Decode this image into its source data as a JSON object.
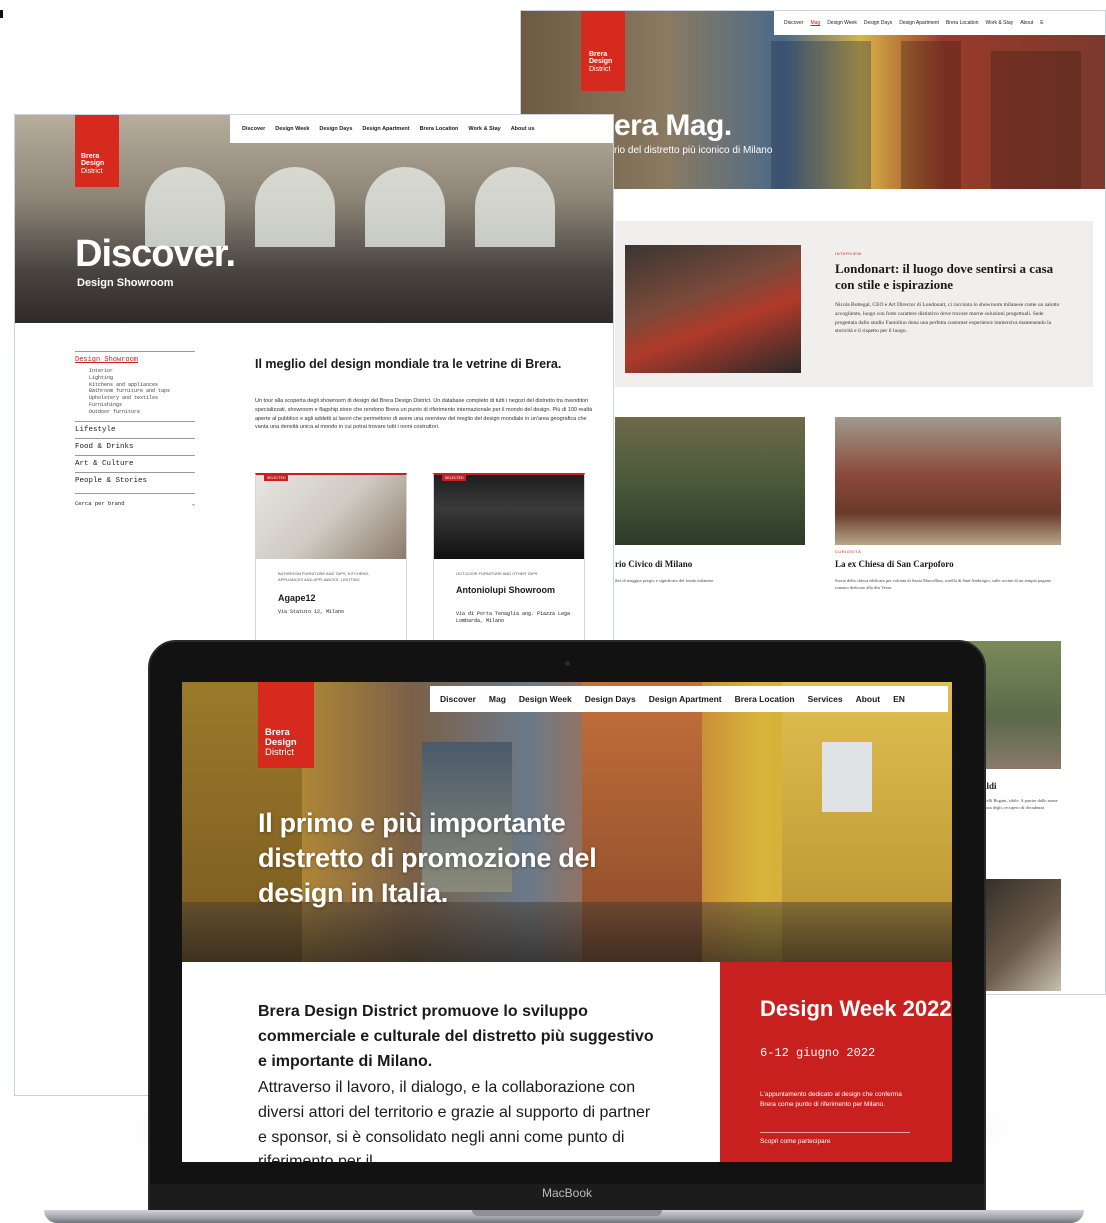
{
  "mag_page": {
    "logo": [
      "Brera",
      "Design",
      "District"
    ],
    "nav": [
      "Discover",
      "Mag",
      "Design Week",
      "Design Days",
      "Design Apartment",
      "Brera Location",
      "Work & Stay",
      "About",
      "E"
    ],
    "active_nav": "Mag",
    "title": "era Mag.",
    "subtitle": "rio del distretto più iconico di Milano",
    "feature": {
      "category": "INTERVIEW",
      "title": "Londonart: il luogo dove sentirsi a casa con stile e ispirazione",
      "text": "Nicola Bottegal, CEO e Art Director di Londonart, ci racconta lo showroom milanese come un salotto accogliente, luogo con forte carattere distintivo dove trovare morne soluzioni progettuali. Sede progettata dallo studio Fantolino dona una perfetta customer experience immersiva mantenendo la storicità e il rispetto per il luogo."
    },
    "cards": [
      {
        "title": "rio Civico di Milano",
        "text": "ibri di maggior pregio e significato del fondo milanese.",
        "category": ""
      },
      {
        "title": "La ex Chiesa di San Carpoforo",
        "text": "Storia della chiesa edificata per volontà di Santa Marcellina, sorella di Sant'Ambrogio, sulle rovine di un tempio pagano romano dedicato alla dea Vesta.",
        "category": "CURIOSITÀ"
      },
      {
        "title": "baldi",
        "text": "i Fratelli Bogani, sibile. A partire dallo nome in storia degli, recupero di decadenza",
        "category": ""
      }
    ]
  },
  "discover_page": {
    "logo": [
      "Brera",
      "Design",
      "District"
    ],
    "nav": [
      "Discover",
      "Design Week",
      "Design Days",
      "Design Apartment",
      "Brera Location",
      "Work & Stay",
      "About us"
    ],
    "title": "Discover.",
    "subtitle": "Design Showroom",
    "sidebar": {
      "active": "Design Showroom",
      "subitems": [
        "Interior",
        "Lighting",
        "Kitchens and appliances",
        "Bathroom furniture and taps",
        "Upholstery and textiles",
        "Furnishings",
        "Outdoor furniture"
      ],
      "items": [
        "Lifestyle",
        "Food & Drinks",
        "Art & Culture",
        "People & Stories"
      ],
      "search": "Cerca per brand"
    },
    "heading": "Il meglio del design mondiale tra le vetrine di Brera.",
    "text": "Un tour alla scoperta degli showroom di design del Brera Design District. Un database completo di tutti i negozi del distretto tra rivenditori specializzati, showroom e flagship store che rendono Brera un punto di riferimento internazionale per il mondo del design. Più di 100 realtà aperte al pubblico e agli addetti ai lavori che permettono di avere una overview del meglio del design mondiale in un'area geografica che vanta una densità unica al mondo in cui potrai trovare tutti i nomi costruttori.",
    "cards": [
      {
        "tag": "SELECTED",
        "category": "BATHROOM FURNITURE AND TAPS, KITCHENS, APPLIANCES AND APPLIANCES, LIGHTING",
        "name": "Agape12",
        "address": "Via Statuto 12, Milano"
      },
      {
        "tag": "SELECTED",
        "category": "OUT-DOOR FURNITURE AND OTHER TAPS",
        "name": "Antoniolupi Showroom",
        "address": "Via di Porta Tenaglia ang. Piazza Lega Lombarda, Milano"
      }
    ]
  },
  "laptop": {
    "brand": "MacBook",
    "screen": {
      "logo": [
        "Brera",
        "Design",
        "District"
      ],
      "nav": [
        "Discover",
        "Mag",
        "Design Week",
        "Design Days",
        "Design Apartment",
        "Brera Location",
        "Services",
        "About",
        "EN"
      ],
      "headline": "Il primo e più importante distretto di promozione del design in Italia.",
      "intro": "Brera Design District promuove lo sviluppo commerciale e culturale del distretto più suggestivo e importante di Milano.",
      "body": "Attraverso il lavoro, il dialogo, e la collaborazione con diversi attori del territorio e grazie al supporto di partner e sponsor, si è consolidato negli anni come punto di riferimento per il",
      "design_week": {
        "title": "Design Week 2022",
        "date": "6-12 giugno 2022",
        "text": "L'appuntamento dedicato al design che conferma Brera come punto di riferimento per Milano.",
        "more": "Scopri come partecipare"
      }
    }
  },
  "colors": {
    "accent": "#c8201e",
    "logo_red": "#d62a1f",
    "laptop_body": "#121212"
  }
}
